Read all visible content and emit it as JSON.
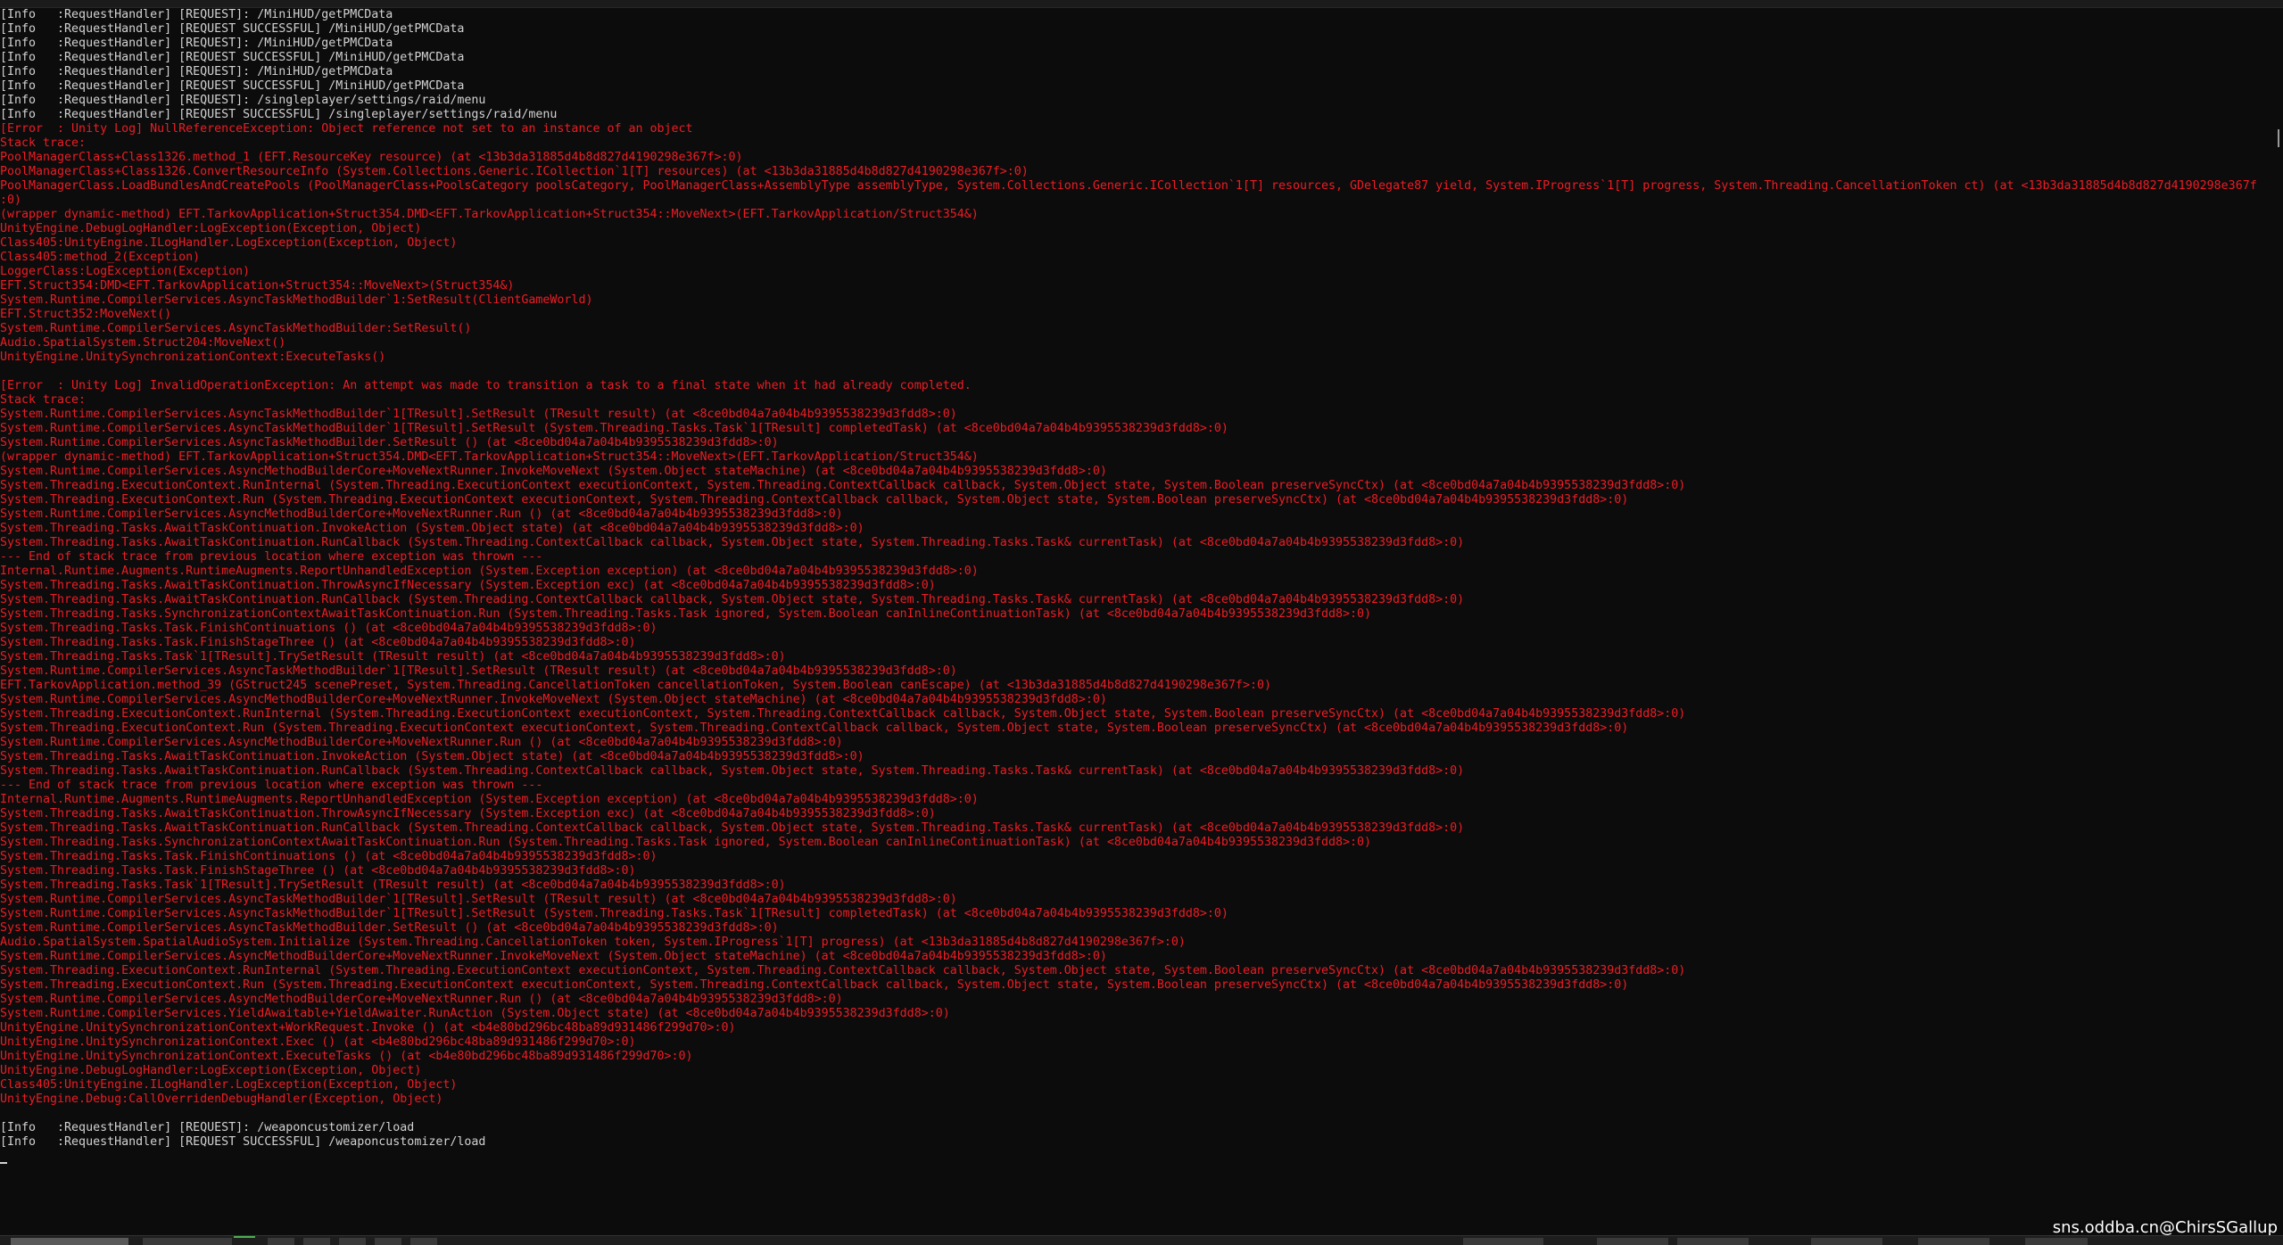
{
  "watermark": "sns.oddba.cn@ChirsSGallup",
  "colors": {
    "info": "#d2d2d2",
    "error": "#ed1c24",
    "background": "#0c0c0c"
  },
  "lines": [
    {
      "t": "info",
      "s": "[Info   :RequestHandler] [REQUEST]: /MiniHUD/getPMCData"
    },
    {
      "t": "info",
      "s": "[Info   :RequestHandler] [REQUEST SUCCESSFUL] /MiniHUD/getPMCData"
    },
    {
      "t": "info",
      "s": "[Info   :RequestHandler] [REQUEST]: /MiniHUD/getPMCData"
    },
    {
      "t": "info",
      "s": "[Info   :RequestHandler] [REQUEST SUCCESSFUL] /MiniHUD/getPMCData"
    },
    {
      "t": "info",
      "s": "[Info   :RequestHandler] [REQUEST]: /MiniHUD/getPMCData"
    },
    {
      "t": "info",
      "s": "[Info   :RequestHandler] [REQUEST SUCCESSFUL] /MiniHUD/getPMCData"
    },
    {
      "t": "info",
      "s": "[Info   :RequestHandler] [REQUEST]: /singleplayer/settings/raid/menu"
    },
    {
      "t": "info",
      "s": "[Info   :RequestHandler] [REQUEST SUCCESSFUL] /singleplayer/settings/raid/menu"
    },
    {
      "t": "err",
      "s": "[Error  : Unity Log] NullReferenceException: Object reference not set to an instance of an object"
    },
    {
      "t": "err",
      "s": "Stack trace:"
    },
    {
      "t": "err",
      "s": "PoolManagerClass+Class1326.method_1 (EFT.ResourceKey resource) (at <13b3da31885d4b8d827d4190298e367f>:0)"
    },
    {
      "t": "err",
      "s": "PoolManagerClass+Class1326.ConvertResourceInfo (System.Collections.Generic.ICollection`1[T] resources) (at <13b3da31885d4b8d827d4190298e367f>:0)"
    },
    {
      "t": "err",
      "s": "PoolManagerClass.LoadBundlesAndCreatePools (PoolManagerClass+PoolsCategory poolsCategory, PoolManagerClass+AssemblyType assemblyType, System.Collections.Generic.ICollection`1[T] resources, GDelegate87 yield, System.IProgress`1[T] progress, System.Threading.CancellationToken ct) (at <13b3da31885d4b8d827d4190298e367f>"
    },
    {
      "t": "err",
      "s": ":0)"
    },
    {
      "t": "err",
      "s": "(wrapper dynamic-method) EFT.TarkovApplication+Struct354.DMD<EFT.TarkovApplication+Struct354::MoveNext>(EFT.TarkovApplication/Struct354&)"
    },
    {
      "t": "err",
      "s": "UnityEngine.DebugLogHandler:LogException(Exception, Object)"
    },
    {
      "t": "err",
      "s": "Class405:UnityEngine.ILogHandler.LogException(Exception, Object)"
    },
    {
      "t": "err",
      "s": "Class405:method_2(Exception)"
    },
    {
      "t": "err",
      "s": "LoggerClass:LogException(Exception)"
    },
    {
      "t": "err",
      "s": "EFT.Struct354:DMD<EFT.TarkovApplication+Struct354::MoveNext>(Struct354&)"
    },
    {
      "t": "err",
      "s": "System.Runtime.CompilerServices.AsyncTaskMethodBuilder`1:SetResult(ClientGameWorld)"
    },
    {
      "t": "err",
      "s": "EFT.Struct352:MoveNext()"
    },
    {
      "t": "err",
      "s": "System.Runtime.CompilerServices.AsyncTaskMethodBuilder:SetResult()"
    },
    {
      "t": "err",
      "s": "Audio.SpatialSystem.Struct204:MoveNext()"
    },
    {
      "t": "err",
      "s": "UnityEngine.UnitySynchronizationContext:ExecuteTasks()"
    },
    {
      "t": "blank",
      "s": ""
    },
    {
      "t": "err",
      "s": "[Error  : Unity Log] InvalidOperationException: An attempt was made to transition a task to a final state when it had already completed."
    },
    {
      "t": "err",
      "s": "Stack trace:"
    },
    {
      "t": "err",
      "s": "System.Runtime.CompilerServices.AsyncTaskMethodBuilder`1[TResult].SetResult (TResult result) (at <8ce0bd04a7a04b4b9395538239d3fdd8>:0)"
    },
    {
      "t": "err",
      "s": "System.Runtime.CompilerServices.AsyncTaskMethodBuilder`1[TResult].SetResult (System.Threading.Tasks.Task`1[TResult] completedTask) (at <8ce0bd04a7a04b4b9395538239d3fdd8>:0)"
    },
    {
      "t": "err",
      "s": "System.Runtime.CompilerServices.AsyncTaskMethodBuilder.SetResult () (at <8ce0bd04a7a04b4b9395538239d3fdd8>:0)"
    },
    {
      "t": "err",
      "s": "(wrapper dynamic-method) EFT.TarkovApplication+Struct354.DMD<EFT.TarkovApplication+Struct354::MoveNext>(EFT.TarkovApplication/Struct354&)"
    },
    {
      "t": "err",
      "s": "System.Runtime.CompilerServices.AsyncMethodBuilderCore+MoveNextRunner.InvokeMoveNext (System.Object stateMachine) (at <8ce0bd04a7a04b4b9395538239d3fdd8>:0)"
    },
    {
      "t": "err",
      "s": "System.Threading.ExecutionContext.RunInternal (System.Threading.ExecutionContext executionContext, System.Threading.ContextCallback callback, System.Object state, System.Boolean preserveSyncCtx) (at <8ce0bd04a7a04b4b9395538239d3fdd8>:0)"
    },
    {
      "t": "err",
      "s": "System.Threading.ExecutionContext.Run (System.Threading.ExecutionContext executionContext, System.Threading.ContextCallback callback, System.Object state, System.Boolean preserveSyncCtx) (at <8ce0bd04a7a04b4b9395538239d3fdd8>:0)"
    },
    {
      "t": "err",
      "s": "System.Runtime.CompilerServices.AsyncMethodBuilderCore+MoveNextRunner.Run () (at <8ce0bd04a7a04b4b9395538239d3fdd8>:0)"
    },
    {
      "t": "err",
      "s": "System.Threading.Tasks.AwaitTaskContinuation.InvokeAction (System.Object state) (at <8ce0bd04a7a04b4b9395538239d3fdd8>:0)"
    },
    {
      "t": "err",
      "s": "System.Threading.Tasks.AwaitTaskContinuation.RunCallback (System.Threading.ContextCallback callback, System.Object state, System.Threading.Tasks.Task& currentTask) (at <8ce0bd04a7a04b4b9395538239d3fdd8>:0)"
    },
    {
      "t": "err",
      "s": "--- End of stack trace from previous location where exception was thrown ---"
    },
    {
      "t": "err",
      "s": "Internal.Runtime.Augments.RuntimeAugments.ReportUnhandledException (System.Exception exception) (at <8ce0bd04a7a04b4b9395538239d3fdd8>:0)"
    },
    {
      "t": "err",
      "s": "System.Threading.Tasks.AwaitTaskContinuation.ThrowAsyncIfNecessary (System.Exception exc) (at <8ce0bd04a7a04b4b9395538239d3fdd8>:0)"
    },
    {
      "t": "err",
      "s": "System.Threading.Tasks.AwaitTaskContinuation.RunCallback (System.Threading.ContextCallback callback, System.Object state, System.Threading.Tasks.Task& currentTask) (at <8ce0bd04a7a04b4b9395538239d3fdd8>:0)"
    },
    {
      "t": "err",
      "s": "System.Threading.Tasks.SynchronizationContextAwaitTaskContinuation.Run (System.Threading.Tasks.Task ignored, System.Boolean canInlineContinuationTask) (at <8ce0bd04a7a04b4b9395538239d3fdd8>:0)"
    },
    {
      "t": "err",
      "s": "System.Threading.Tasks.Task.FinishContinuations () (at <8ce0bd04a7a04b4b9395538239d3fdd8>:0)"
    },
    {
      "t": "err",
      "s": "System.Threading.Tasks.Task.FinishStageThree () (at <8ce0bd04a7a04b4b9395538239d3fdd8>:0)"
    },
    {
      "t": "err",
      "s": "System.Threading.Tasks.Task`1[TResult].TrySetResult (TResult result) (at <8ce0bd04a7a04b4b9395538239d3fdd8>:0)"
    },
    {
      "t": "err",
      "s": "System.Runtime.CompilerServices.AsyncTaskMethodBuilder`1[TResult].SetResult (TResult result) (at <8ce0bd04a7a04b4b9395538239d3fdd8>:0)"
    },
    {
      "t": "err",
      "s": "EFT.TarkovApplication.method_39 (GStruct245 scenePreset, System.Threading.CancellationToken cancellationToken, System.Boolean canEscape) (at <13b3da31885d4b8d827d4190298e367f>:0)"
    },
    {
      "t": "err",
      "s": "System.Runtime.CompilerServices.AsyncMethodBuilderCore+MoveNextRunner.InvokeMoveNext (System.Object stateMachine) (at <8ce0bd04a7a04b4b9395538239d3fdd8>:0)"
    },
    {
      "t": "err",
      "s": "System.Threading.ExecutionContext.RunInternal (System.Threading.ExecutionContext executionContext, System.Threading.ContextCallback callback, System.Object state, System.Boolean preserveSyncCtx) (at <8ce0bd04a7a04b4b9395538239d3fdd8>:0)"
    },
    {
      "t": "err",
      "s": "System.Threading.ExecutionContext.Run (System.Threading.ExecutionContext executionContext, System.Threading.ContextCallback callback, System.Object state, System.Boolean preserveSyncCtx) (at <8ce0bd04a7a04b4b9395538239d3fdd8>:0)"
    },
    {
      "t": "err",
      "s": "System.Runtime.CompilerServices.AsyncMethodBuilderCore+MoveNextRunner.Run () (at <8ce0bd04a7a04b4b9395538239d3fdd8>:0)"
    },
    {
      "t": "err",
      "s": "System.Threading.Tasks.AwaitTaskContinuation.InvokeAction (System.Object state) (at <8ce0bd04a7a04b4b9395538239d3fdd8>:0)"
    },
    {
      "t": "err",
      "s": "System.Threading.Tasks.AwaitTaskContinuation.RunCallback (System.Threading.ContextCallback callback, System.Object state, System.Threading.Tasks.Task& currentTask) (at <8ce0bd04a7a04b4b9395538239d3fdd8>:0)"
    },
    {
      "t": "err",
      "s": "--- End of stack trace from previous location where exception was thrown ---"
    },
    {
      "t": "err",
      "s": "Internal.Runtime.Augments.RuntimeAugments.ReportUnhandledException (System.Exception exception) (at <8ce0bd04a7a04b4b9395538239d3fdd8>:0)"
    },
    {
      "t": "err",
      "s": "System.Threading.Tasks.AwaitTaskContinuation.ThrowAsyncIfNecessary (System.Exception exc) (at <8ce0bd04a7a04b4b9395538239d3fdd8>:0)"
    },
    {
      "t": "err",
      "s": "System.Threading.Tasks.AwaitTaskContinuation.RunCallback (System.Threading.ContextCallback callback, System.Object state, System.Threading.Tasks.Task& currentTask) (at <8ce0bd04a7a04b4b9395538239d3fdd8>:0)"
    },
    {
      "t": "err",
      "s": "System.Threading.Tasks.SynchronizationContextAwaitTaskContinuation.Run (System.Threading.Tasks.Task ignored, System.Boolean canInlineContinuationTask) (at <8ce0bd04a7a04b4b9395538239d3fdd8>:0)"
    },
    {
      "t": "err",
      "s": "System.Threading.Tasks.Task.FinishContinuations () (at <8ce0bd04a7a04b4b9395538239d3fdd8>:0)"
    },
    {
      "t": "err",
      "s": "System.Threading.Tasks.Task.FinishStageThree () (at <8ce0bd04a7a04b4b9395538239d3fdd8>:0)"
    },
    {
      "t": "err",
      "s": "System.Threading.Tasks.Task`1[TResult].TrySetResult (TResult result) (at <8ce0bd04a7a04b4b9395538239d3fdd8>:0)"
    },
    {
      "t": "err",
      "s": "System.Runtime.CompilerServices.AsyncTaskMethodBuilder`1[TResult].SetResult (TResult result) (at <8ce0bd04a7a04b4b9395538239d3fdd8>:0)"
    },
    {
      "t": "err",
      "s": "System.Runtime.CompilerServices.AsyncTaskMethodBuilder`1[TResult].SetResult (System.Threading.Tasks.Task`1[TResult] completedTask) (at <8ce0bd04a7a04b4b9395538239d3fdd8>:0)"
    },
    {
      "t": "err",
      "s": "System.Runtime.CompilerServices.AsyncTaskMethodBuilder.SetResult () (at <8ce0bd04a7a04b4b9395538239d3fdd8>:0)"
    },
    {
      "t": "err",
      "s": "Audio.SpatialSystem.SpatialAudioSystem.Initialize (System.Threading.CancellationToken token, System.IProgress`1[T] progress) (at <13b3da31885d4b8d827d4190298e367f>:0)"
    },
    {
      "t": "err",
      "s": "System.Runtime.CompilerServices.AsyncMethodBuilderCore+MoveNextRunner.InvokeMoveNext (System.Object stateMachine) (at <8ce0bd04a7a04b4b9395538239d3fdd8>:0)"
    },
    {
      "t": "err",
      "s": "System.Threading.ExecutionContext.RunInternal (System.Threading.ExecutionContext executionContext, System.Threading.ContextCallback callback, System.Object state, System.Boolean preserveSyncCtx) (at <8ce0bd04a7a04b4b9395538239d3fdd8>:0)"
    },
    {
      "t": "err",
      "s": "System.Threading.ExecutionContext.Run (System.Threading.ExecutionContext executionContext, System.Threading.ContextCallback callback, System.Object state, System.Boolean preserveSyncCtx) (at <8ce0bd04a7a04b4b9395538239d3fdd8>:0)"
    },
    {
      "t": "err",
      "s": "System.Runtime.CompilerServices.AsyncMethodBuilderCore+MoveNextRunner.Run () (at <8ce0bd04a7a04b4b9395538239d3fdd8>:0)"
    },
    {
      "t": "err",
      "s": "System.Runtime.CompilerServices.YieldAwaitable+YieldAwaiter.RunAction (System.Object state) (at <8ce0bd04a7a04b4b9395538239d3fdd8>:0)"
    },
    {
      "t": "err",
      "s": "UnityEngine.UnitySynchronizationContext+WorkRequest.Invoke () (at <b4e80bd296bc48ba89d931486f299d70>:0)"
    },
    {
      "t": "err",
      "s": "UnityEngine.UnitySynchronizationContext.Exec () (at <b4e80bd296bc48ba89d931486f299d70>:0)"
    },
    {
      "t": "err",
      "s": "UnityEngine.UnitySynchronizationContext.ExecuteTasks () (at <b4e80bd296bc48ba89d931486f299d70>:0)"
    },
    {
      "t": "err",
      "s": "UnityEngine.DebugLogHandler:LogException(Exception, Object)"
    },
    {
      "t": "err",
      "s": "Class405:UnityEngine.ILogHandler.LogException(Exception, Object)"
    },
    {
      "t": "err",
      "s": "UnityEngine.Debug:CallOverridenDebugHandler(Exception, Object)"
    },
    {
      "t": "blank",
      "s": ""
    },
    {
      "t": "info",
      "s": "[Info   :RequestHandler] [REQUEST]: /weaponcustomizer/load"
    },
    {
      "t": "info",
      "s": "[Info   :RequestHandler] [REQUEST SUCCESSFUL] /weaponcustomizer/load"
    }
  ]
}
